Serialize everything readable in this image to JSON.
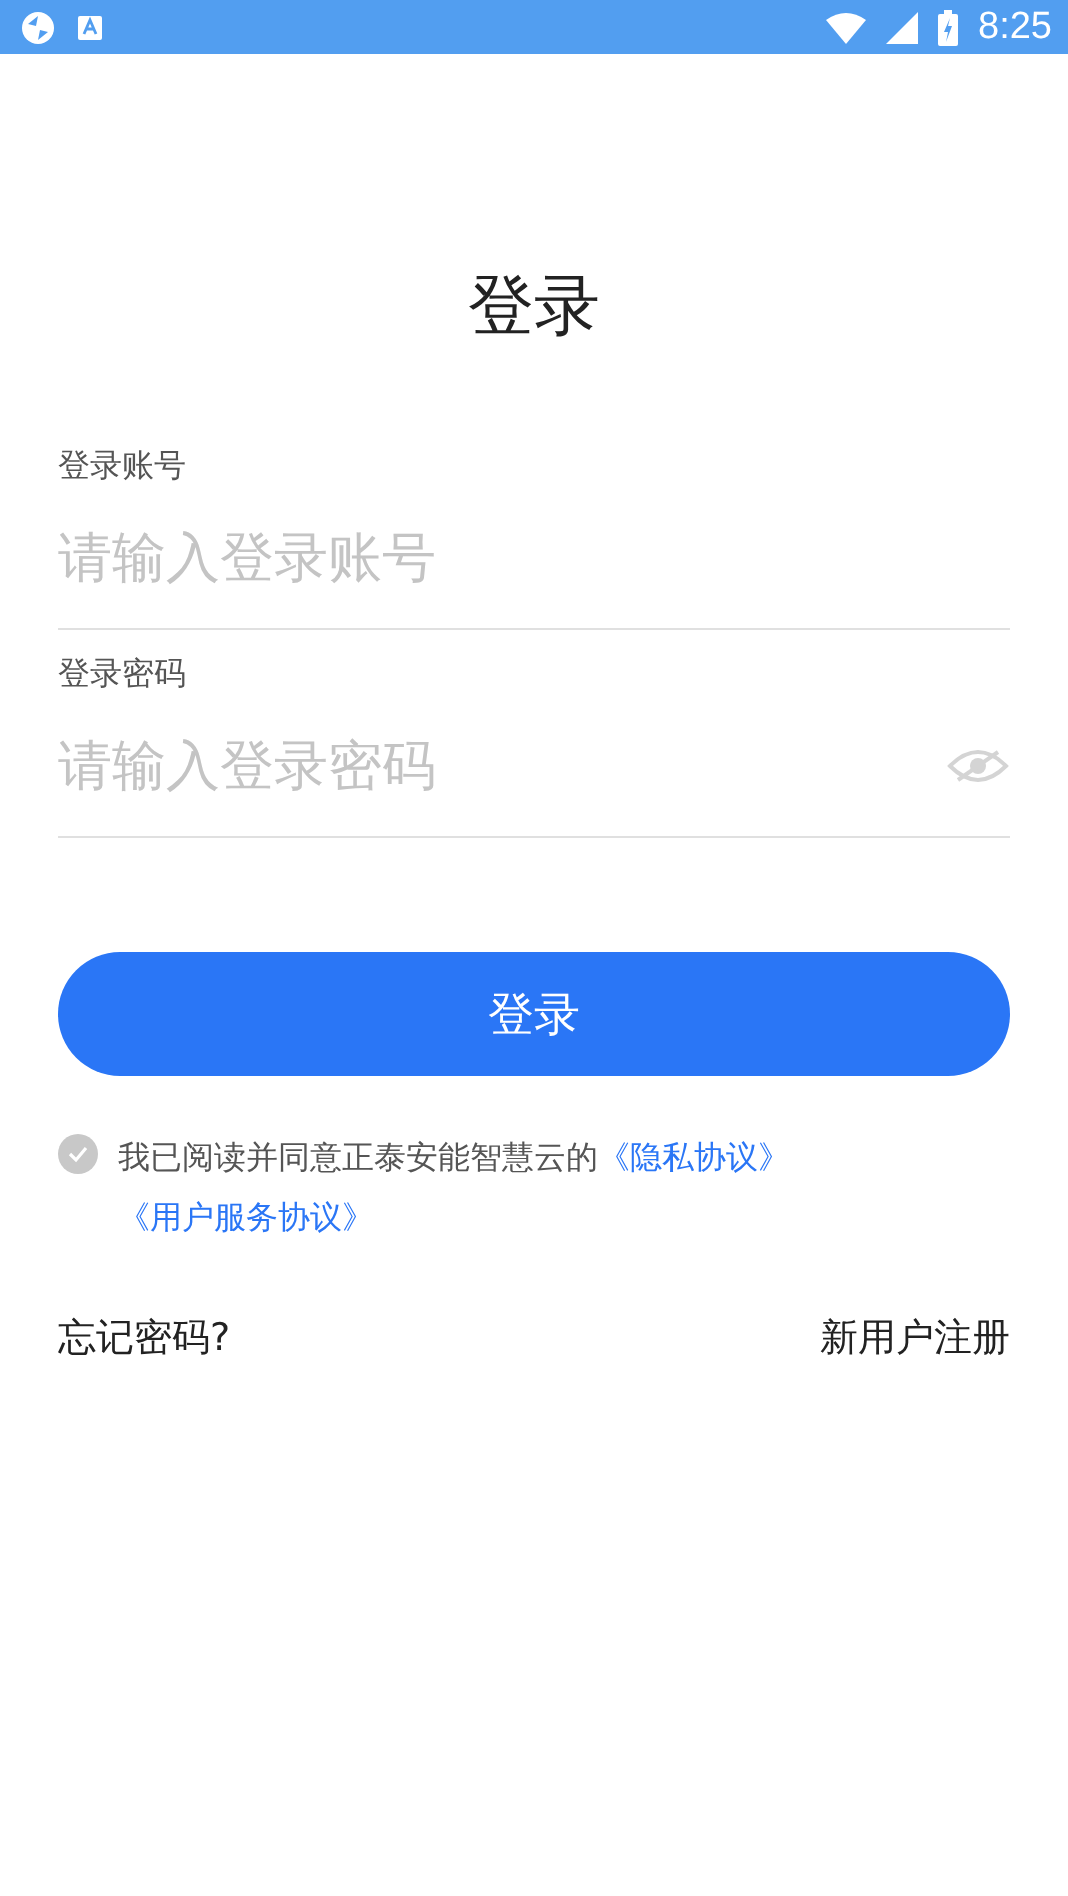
{
  "status_bar": {
    "time": "8:25"
  },
  "title": "登录",
  "fields": [
    {
      "kind": "text",
      "label": "登录账号",
      "placeholder": "请输入登录账号"
    },
    {
      "kind": "password",
      "label": "登录密码",
      "placeholder": "请输入登录密码",
      "visible": false
    }
  ],
  "login_button": "登录",
  "agreement": {
    "checked": false,
    "text": "我已阅读并同意正泰安能智慧云的",
    "links": [
      "《隐私协议》",
      "《用户服务协议》"
    ]
  },
  "forgot_password": "忘记密码?",
  "register": "新用户注册"
}
